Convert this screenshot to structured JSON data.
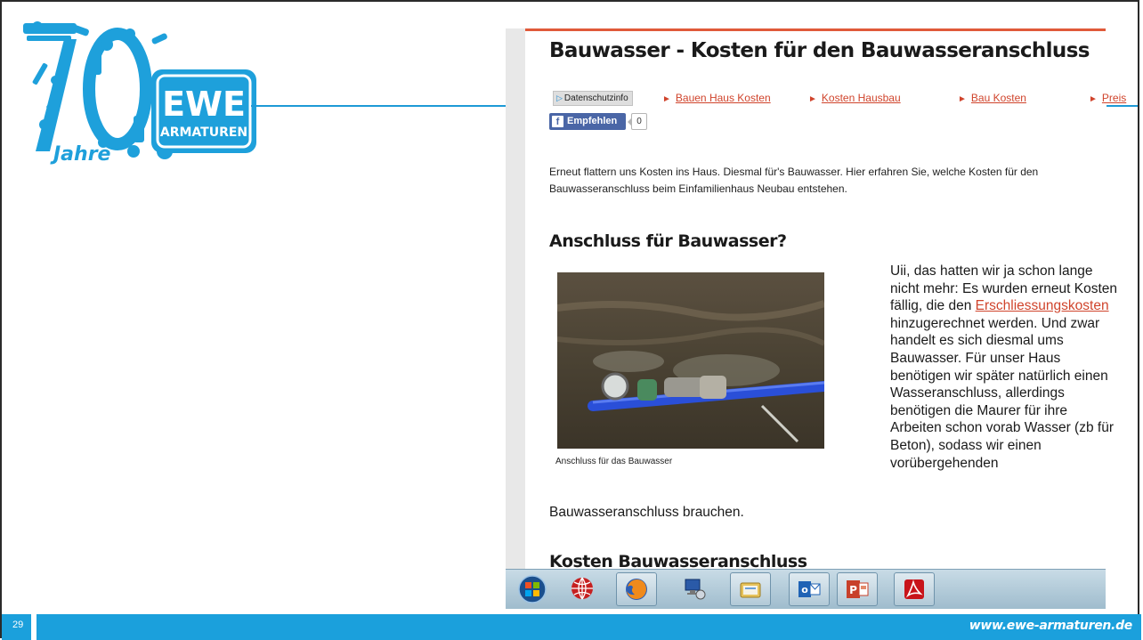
{
  "slide": {
    "number": "29",
    "footer_url": "www.ewe-armaturen.de"
  },
  "logo": {
    "brand_top": "EWE",
    "brand_bottom": "ARMATUREN",
    "years_number": "70",
    "years_word": "Jahre"
  },
  "article": {
    "title": "Bauwasser - Kosten für den Bauwasseranschluss",
    "datenschutz_label": "Datenschutzinfo",
    "nav_links": [
      "Bauen Haus Kosten",
      "Kosten Hausbau",
      "Bau Kosten",
      "Preis"
    ],
    "fb_label": "Empfehlen",
    "fb_count": "0",
    "intro": "Erneut flattern uns Kosten ins Haus. Diesmal für's Bauwasser. Hier erfahren Sie, welche Kosten für den Bauwasseranschluss beim Einfamilienhaus Neubau entstehen.",
    "heading_1": "Anschluss für Bauwasser?",
    "photo_caption": "Anschluss für das Bauwasser",
    "side_text_before": "Uii, das hatten wir ja schon lange nicht mehr: Es wurden erneut Kosten fällig, die den ",
    "side_text_link": "Erschliessungskosten",
    "side_text_after": " hinzugerechnet werden. Und zwar handelt es sich diesmal ums Bauwasser. Für unser Haus benötigen wir später natürlich einen Wasseranschluss, allerdings benötigen die Maurer für ihre Arbeiten schon vorab Wasser (zb für Beton), sodass wir einen vorübergehenden",
    "body_tail": "Bauwasseranschluss brauchen.",
    "heading_2": "Kosten Bauwasseranschluss"
  },
  "taskbar": {
    "items": [
      "start-orb-icon",
      "network-globe-icon",
      "firefox-icon",
      "remote-desktop-icon",
      "file-explorer-icon",
      "outlook-icon",
      "powerpoint-icon",
      "acrobat-icon"
    ]
  },
  "colors": {
    "brand_blue": "#1ba0dc",
    "link_red": "#d0442c",
    "facebook_blue": "#4a66a6"
  }
}
